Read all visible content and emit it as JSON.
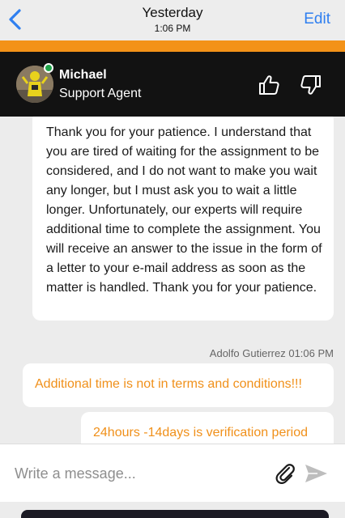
{
  "nav": {
    "title": "Yesterday",
    "time": "1:06 PM",
    "edit_label": "Edit",
    "back_icon": "chevron-left-icon"
  },
  "agent": {
    "name": "Michael",
    "role": "Support Agent",
    "status": "online",
    "status_color": "#1fa34a"
  },
  "messages": [
    {
      "from": "agent",
      "text": "Thank you for your patience. I understand that you are tired of waiting for the assignment to be considered, and I do not want to make you wait any longer, but I must ask you to wait a little longer. Unfortunately, our experts will require additional time to complete the assignment. You will receive an answer to the issue in the form of a letter to your e-mail address as soon as the matter is handled. Thank you for your patience."
    },
    {
      "from": "user",
      "meta": "Adolfo Gutierrez 01:06 PM",
      "text": "Additional time is not in terms and conditions!!!"
    },
    {
      "from": "user",
      "text": "24hours -14days is verification period"
    }
  ],
  "composer": {
    "placeholder": "Write a message..."
  },
  "colors": {
    "accent": "#f39218",
    "link": "#2f7ff0",
    "user_text": "#f0901a",
    "header_bg": "#121212"
  }
}
